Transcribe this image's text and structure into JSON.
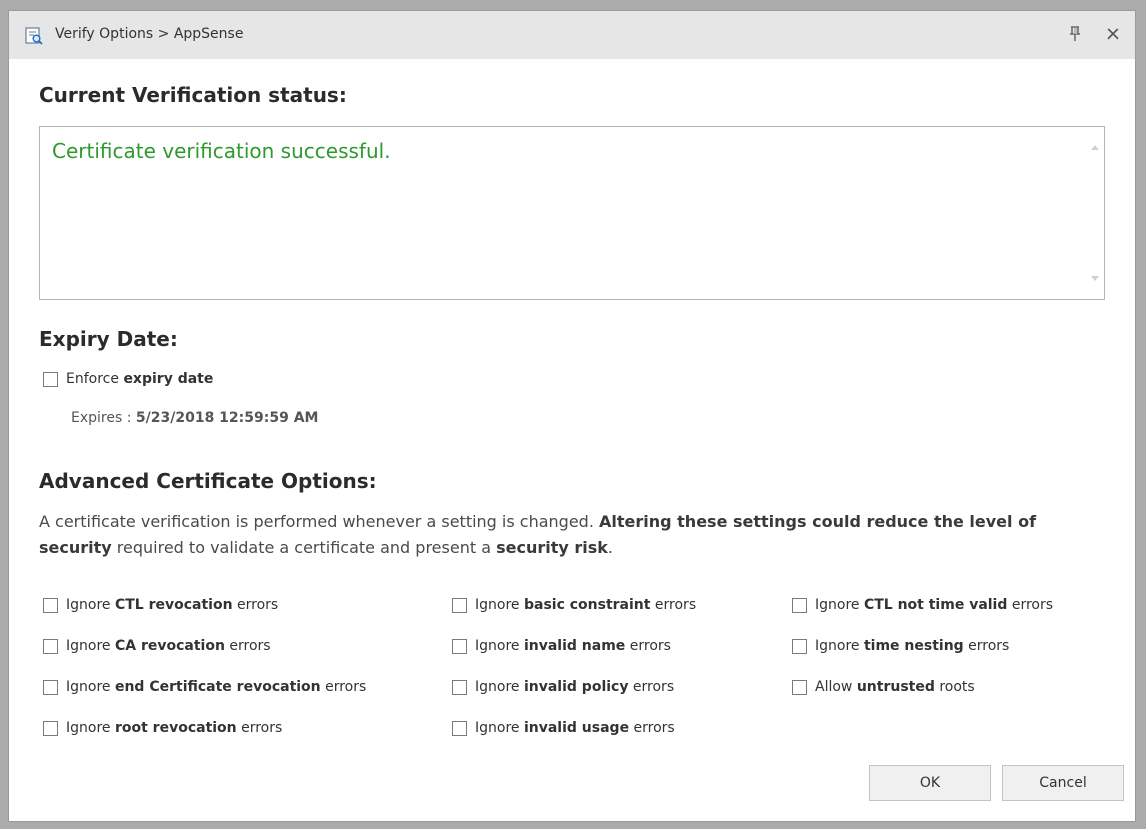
{
  "window": {
    "title": "Verify Options > AppSense",
    "icons": {
      "app": "certificate-search-icon",
      "pin": "pin-icon",
      "close": "close-icon"
    }
  },
  "verification": {
    "heading": "Current Verification status:",
    "status": "Certificate verification successful.",
    "status_color": "#2e9a2e"
  },
  "expiry": {
    "heading": "Expiry Date:",
    "enforce_prefix": "Enforce",
    "enforce_bold": "expiry date",
    "enforce_checked": false,
    "expires_label": "Expires :",
    "expires_value": "5/23/2018 12:59:59 AM"
  },
  "advanced": {
    "heading": "Advanced Certificate Options:",
    "desc1": "A certificate verification is performed whenever a setting is changed.",
    "desc_bold1": "Altering these settings could reduce the level of security",
    "desc2": "required to validate a certificate and present a",
    "desc_bold2": "security risk",
    "desc3": ".",
    "options": [
      {
        "pre": "Ignore",
        "bold": "CTL revocation",
        "post": "errors",
        "checked": false
      },
      {
        "pre": "Ignore",
        "bold": "CA revocation",
        "post": "errors",
        "checked": false
      },
      {
        "pre": "Ignore",
        "bold": "end Certificate revocation",
        "post": "errors",
        "checked": false
      },
      {
        "pre": "Ignore",
        "bold": "root revocation",
        "post": "errors",
        "checked": false
      },
      {
        "pre": "Ignore",
        "bold": "basic constraint",
        "post": "errors",
        "checked": false
      },
      {
        "pre": "Ignore",
        "bold": "invalid name",
        "post": "errors",
        "checked": false
      },
      {
        "pre": "Ignore",
        "bold": "invalid policy",
        "post": "errors",
        "checked": false
      },
      {
        "pre": "Ignore",
        "bold": "invalid usage",
        "post": "errors",
        "checked": false
      },
      {
        "pre": "Ignore",
        "bold": "CTL not time valid",
        "post": "errors",
        "checked": false
      },
      {
        "pre": "Ignore",
        "bold": "time nesting",
        "post": "errors",
        "checked": false
      },
      {
        "pre": "Allow",
        "bold": "untrusted",
        "post": "roots",
        "checked": false
      }
    ]
  },
  "buttons": {
    "ok": "OK",
    "cancel": "Cancel"
  }
}
